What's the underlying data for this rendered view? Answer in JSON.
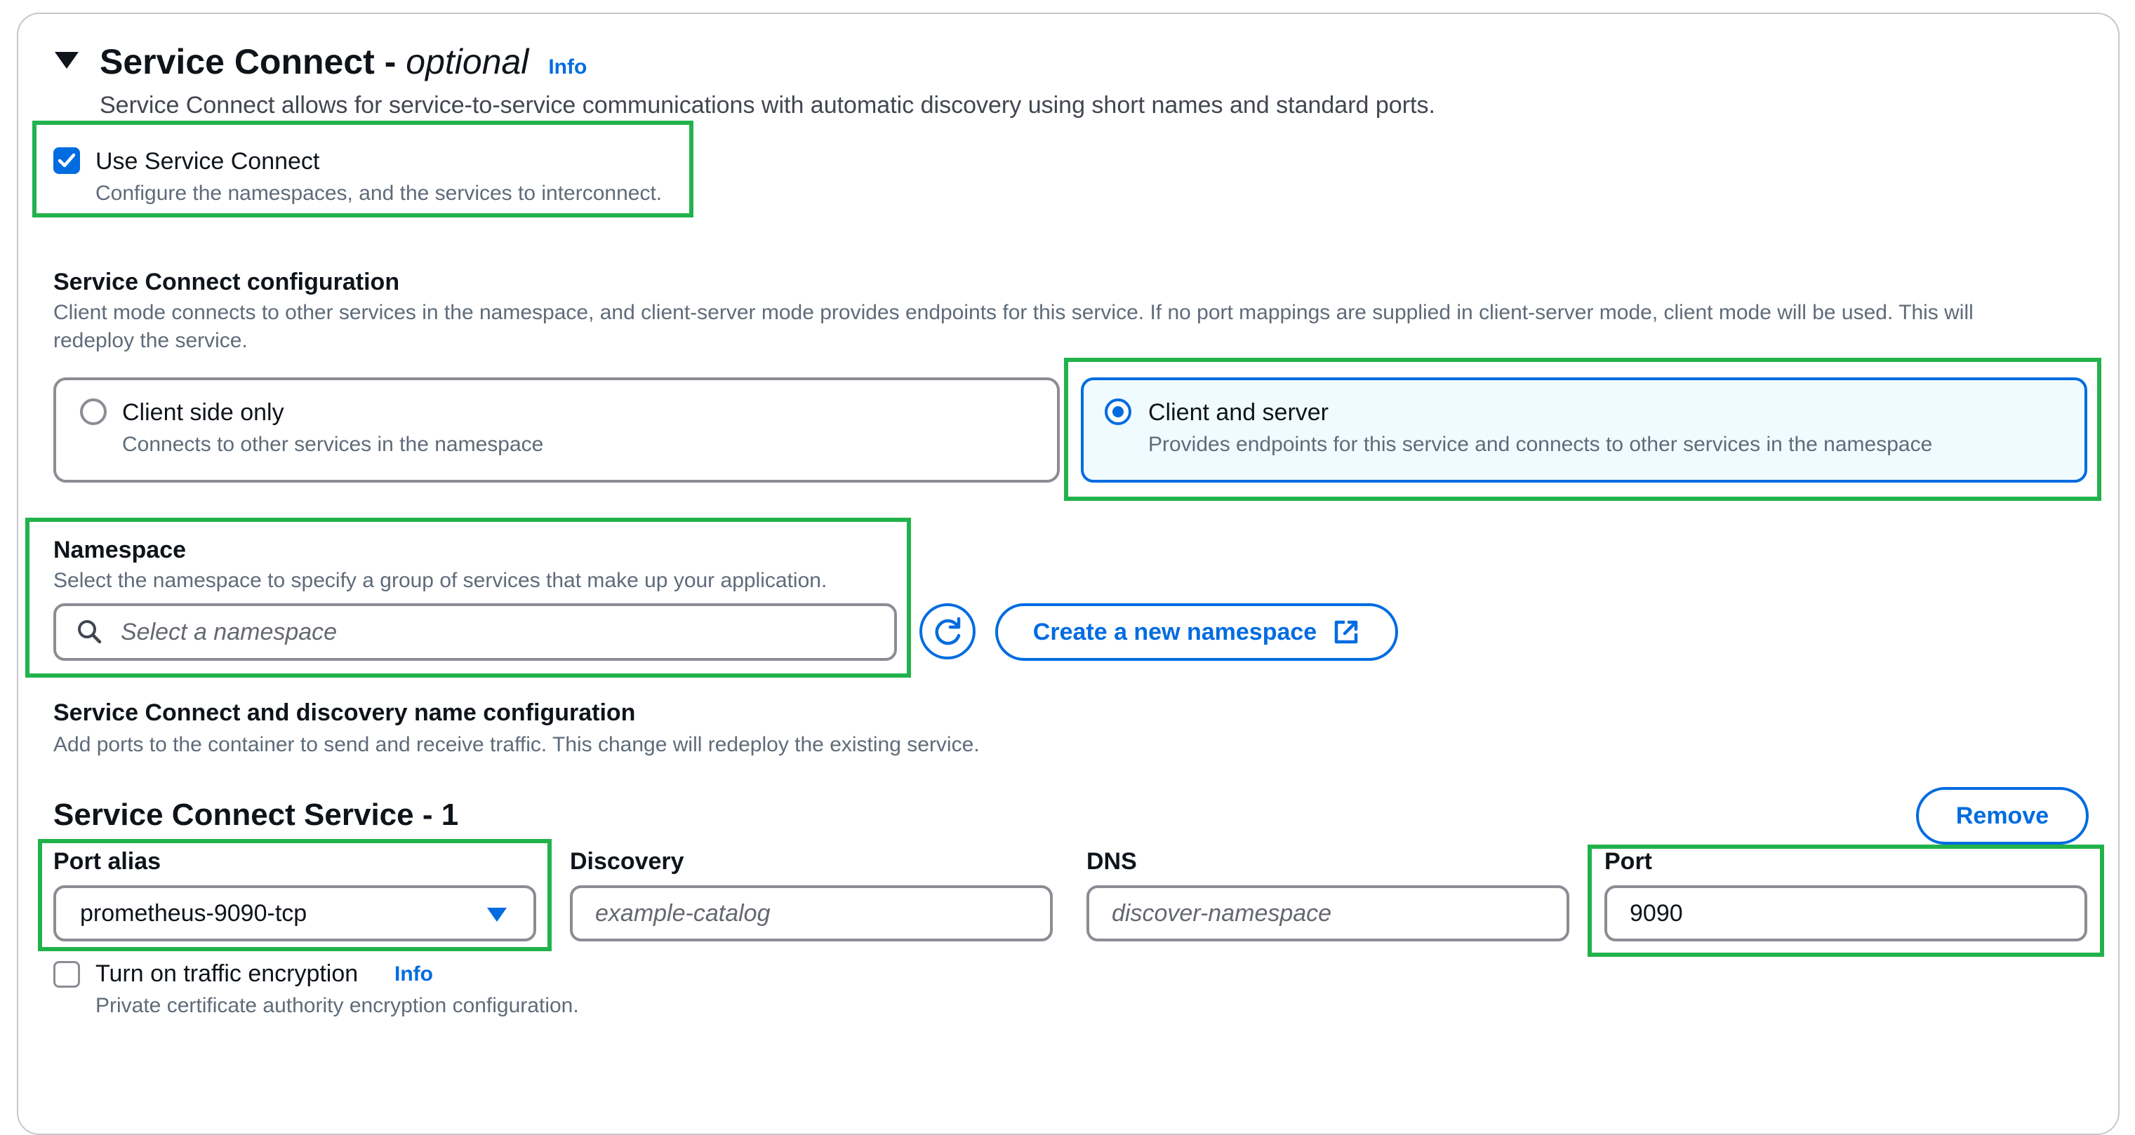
{
  "section": {
    "title": "Service Connect - ",
    "title_optional": "optional",
    "info_link": "Info",
    "description": "Service Connect allows for service-to-service communications with automatic discovery using short names and standard ports."
  },
  "use_service_connect": {
    "label": "Use Service Connect",
    "description": "Configure the namespaces, and the services to interconnect.",
    "checked": true
  },
  "configuration": {
    "title": "Service Connect configuration",
    "description_line1": "Client mode connects to other services in the namespace, and client-server mode provides endpoints for this service. If no port mappings are supplied in client-server mode, client mode will be used. This will",
    "description_line2": "redeploy the service.",
    "options": [
      {
        "label": "Client side only",
        "description": "Connects to other services in the namespace",
        "selected": false
      },
      {
        "label": "Client and server",
        "description": "Provides endpoints for this service and connects to other services in the namespace",
        "selected": true
      }
    ]
  },
  "namespace": {
    "title": "Namespace",
    "description": "Select the namespace to specify a group of services that make up your application.",
    "placeholder": "Select a namespace",
    "create_button": "Create a new namespace"
  },
  "discovery_config": {
    "title": "Service Connect and discovery name configuration",
    "description": "Add ports to the container to send and receive traffic. This change will redeploy the existing service."
  },
  "service": {
    "title": "Service Connect Service - 1",
    "remove_button": "Remove",
    "port_alias": {
      "label": "Port alias",
      "value": "prometheus-9090-tcp"
    },
    "discovery": {
      "label": "Discovery",
      "placeholder": "example-catalog"
    },
    "dns": {
      "label": "DNS",
      "placeholder": "discover-namespace"
    },
    "port": {
      "label": "Port",
      "value": "9090"
    }
  },
  "encryption": {
    "label": "Turn on traffic encryption",
    "info_link": "Info",
    "description": "Private certificate authority encryption configuration.",
    "checked": false
  },
  "colors": {
    "accent": "#006ce0",
    "highlight": "#22b24c",
    "selected_card_bg": "#f0fbff"
  }
}
